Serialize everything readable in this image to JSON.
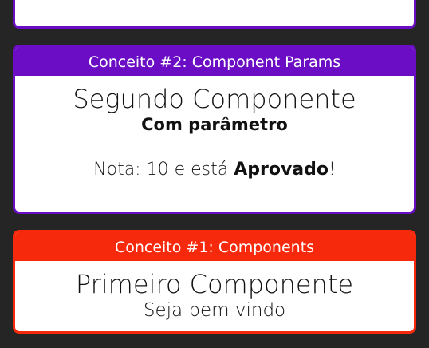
{
  "cards": [
    {
      "header": "Conceito #2: Component Params",
      "title": "Segundo Componente",
      "subtitle": "Com parâmetro",
      "grade_prefix": "Nota: 10 e está ",
      "grade_status": "Aprovado",
      "grade_suffix": "!",
      "accent": "#6a0dc4"
    },
    {
      "header": "Conceito #1: Components",
      "title": "Primeiro Componente",
      "subtitle": "Seja bem vindo",
      "accent": "#f7290c"
    }
  ],
  "colors": {
    "background": "#252525",
    "card_body": "#ffffff"
  }
}
